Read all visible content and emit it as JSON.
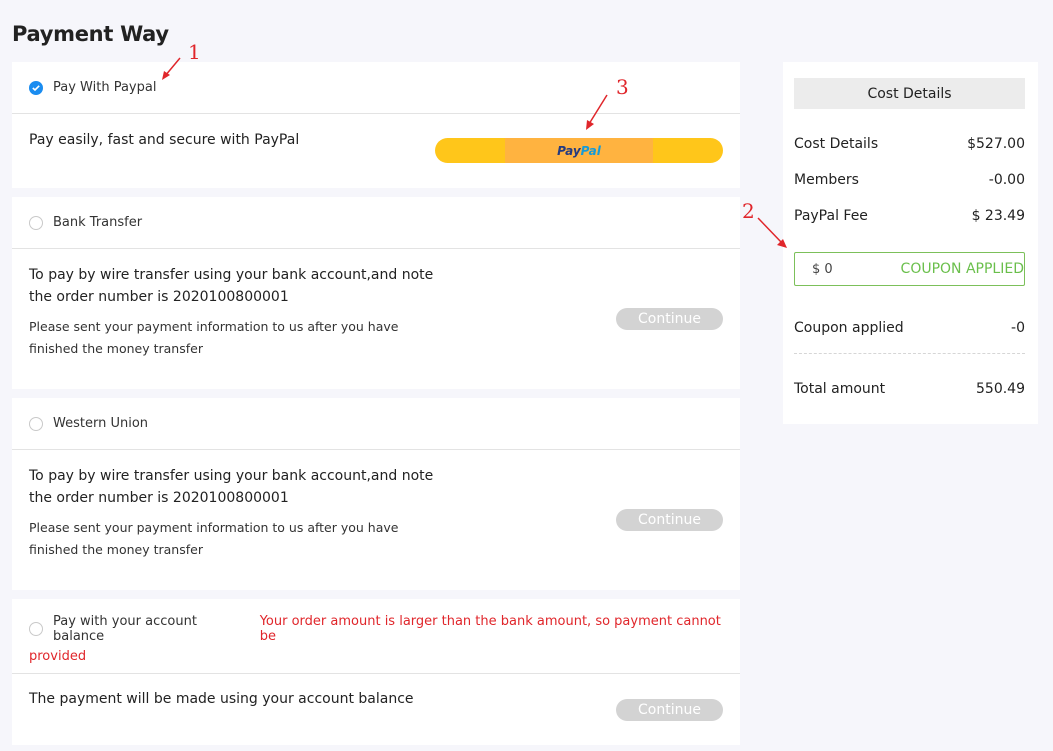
{
  "page_title": "Payment Way",
  "payment_options": [
    {
      "label": "Pay With Paypal",
      "selected": true,
      "description": "Pay easily, fast and secure with PayPal",
      "button_text_1": "Pay",
      "button_text_2": "Pal"
    },
    {
      "label": "Bank Transfer",
      "selected": false,
      "description_line1": "To pay by wire transfer using your bank account,and note",
      "description_line2": "the order number is 2020100800001",
      "note_line1": "Please sent your payment information to us after you have",
      "note_line2": "finished the money transfer",
      "button": "Continue"
    },
    {
      "label": "Western Union",
      "selected": false,
      "description_line1": "To pay by wire transfer using your bank account,and note",
      "description_line2": "the order number is 2020100800001",
      "note_line1": "Please sent your payment information to us after you have",
      "note_line2": "finished the money transfer",
      "button": "Continue"
    },
    {
      "label": "Pay with your account balance",
      "selected": false,
      "error_line1": "Your order amount is larger than the bank amount, so payment cannot be",
      "error_line2": "provided",
      "description": "The payment will be made using your account balance",
      "button": "Continue"
    }
  ],
  "cost_details": {
    "title": "Cost Details",
    "rows": [
      {
        "label": "Cost Details",
        "value": "$527.00"
      },
      {
        "label": "Members",
        "value": "-0.00"
      },
      {
        "label": "PayPal Fee",
        "value": "$ 23.49"
      }
    ],
    "coupon_input": "$ 0",
    "coupon_status": "COUPON APPLIED",
    "coupon_applied_label": "Coupon applied",
    "coupon_applied_value": "-0",
    "total_label": "Total amount",
    "total_value": "550.49"
  },
  "annotations": [
    "1",
    "2",
    "3"
  ],
  "colors": {
    "accent": "#1a8cf0",
    "error": "#e0262b",
    "coupon_green": "#6abf4b",
    "paypal_yellow": "#ffc61a",
    "disabled_button": "#d3d3d3"
  }
}
